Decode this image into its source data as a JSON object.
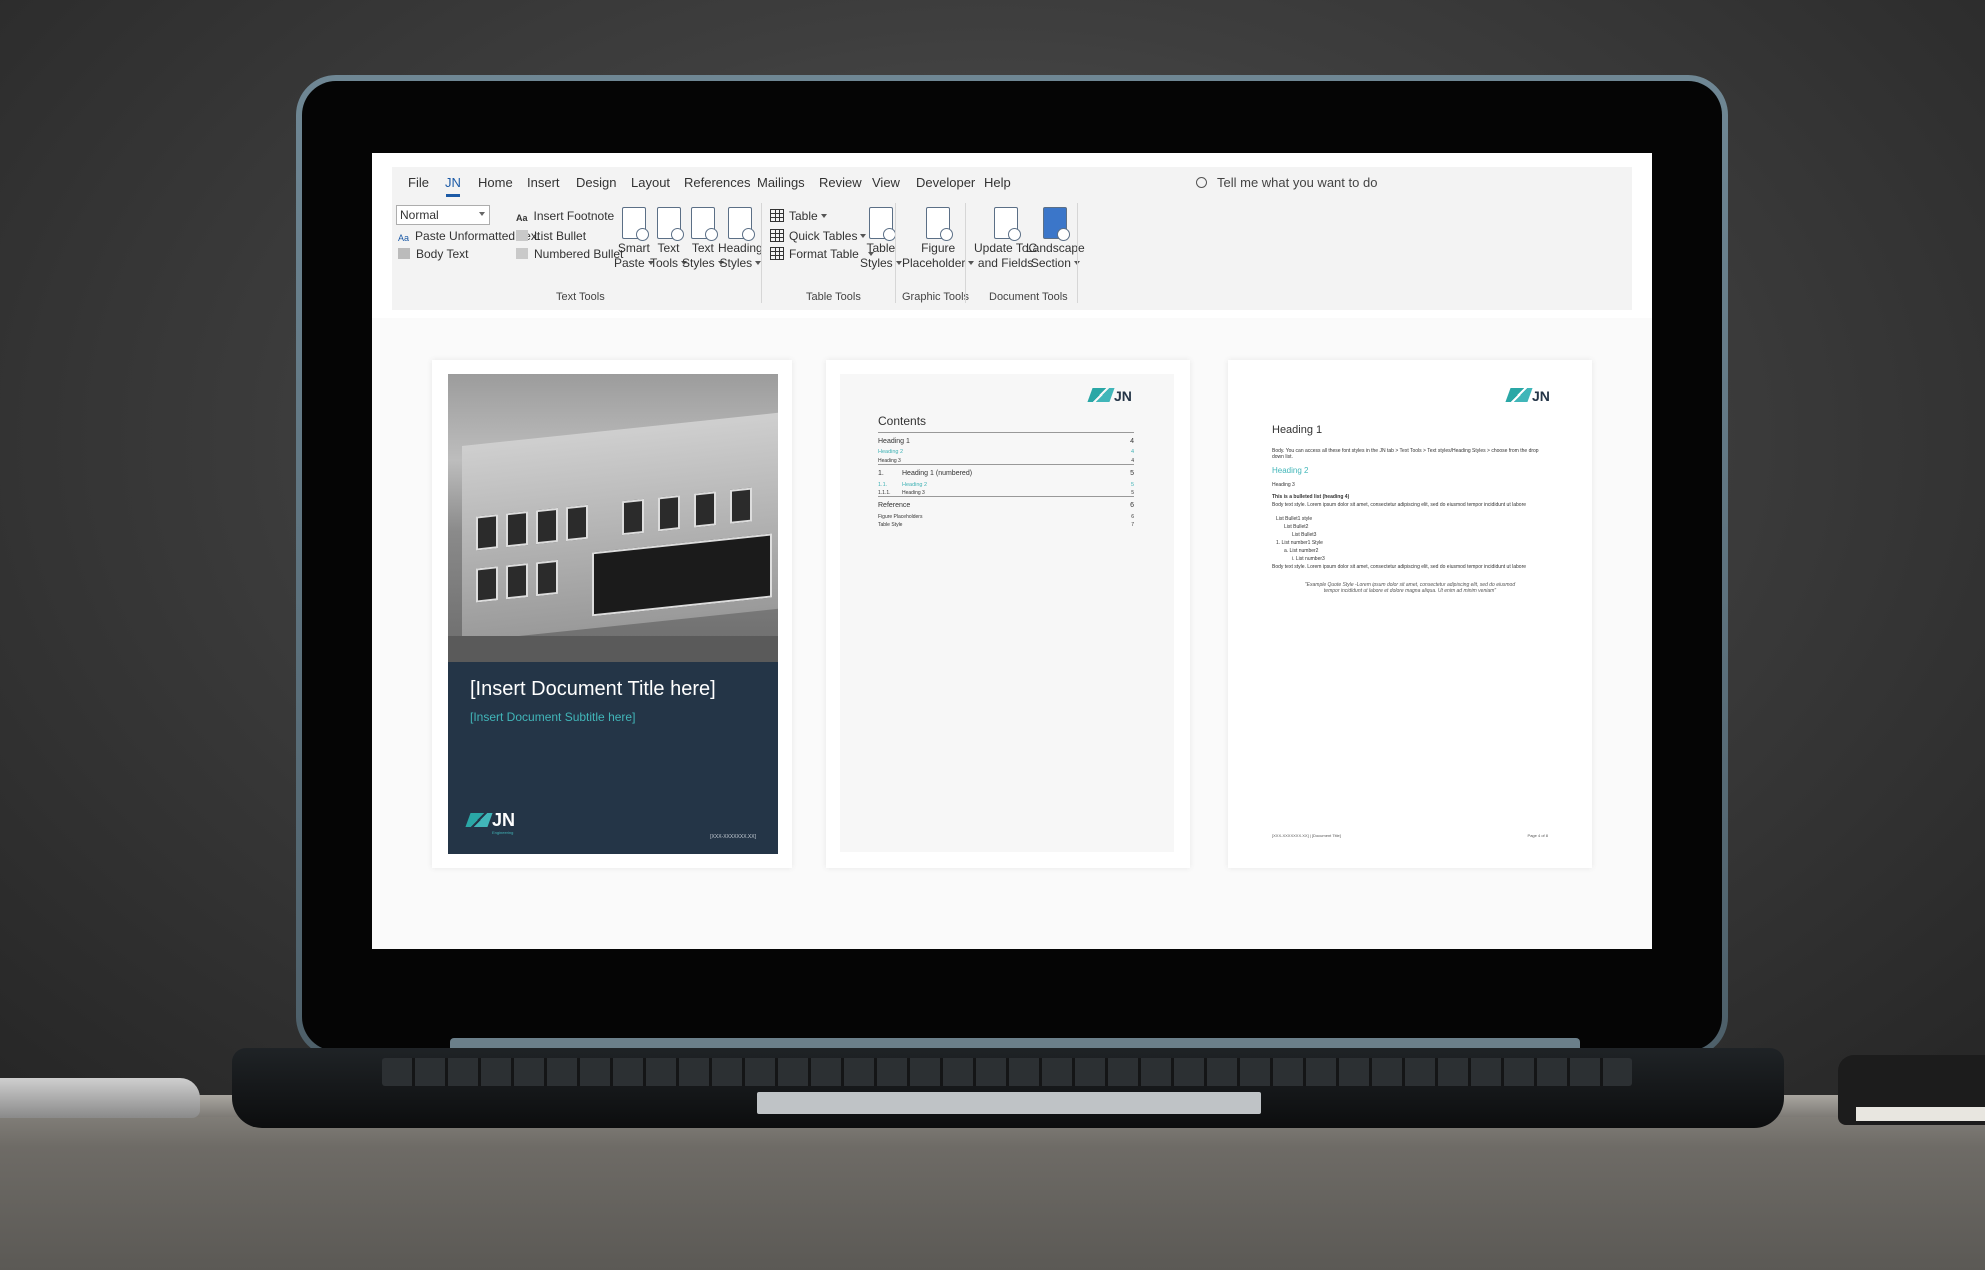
{
  "ribbon": {
    "tabs": [
      "File",
      "JN",
      "Home",
      "Insert",
      "Design",
      "Layout",
      "References",
      "Mailings",
      "Review",
      "View",
      "Developer",
      "Help"
    ],
    "active_tab": "JN",
    "tell_me": "Tell me what you want to do",
    "text_tools": {
      "style_value": "Normal",
      "paste_unformatted": "Paste Unformatted Text",
      "body_text": "Body Text",
      "insert_footnote": "Insert Footnote",
      "list_bullet": "List Bullet",
      "numbered_bullet": "Numbered Bullet",
      "smart_paste": [
        "Smart",
        "Paste"
      ],
      "text_tools_btn": [
        "Text",
        "Tools"
      ],
      "text_styles": [
        "Text",
        "Styles"
      ],
      "heading_styles": [
        "Heading",
        "Styles"
      ],
      "label": "Text Tools"
    },
    "table_tools": {
      "table": "Table",
      "quick_tables": "Quick Tables",
      "format_table": "Format Table",
      "table_styles": [
        "Table",
        "Styles"
      ],
      "label": "Table Tools"
    },
    "graphic_tools": {
      "figure_placeholder": [
        "Figure",
        "Placeholder"
      ],
      "label": "Graphic Tools"
    },
    "document_tools": {
      "update_toc": [
        "Update ToC",
        "and Fields"
      ],
      "landscape": [
        "Landscape",
        "Section"
      ],
      "label": "Document Tools"
    }
  },
  "cover": {
    "title": "[Insert Document Title here]",
    "subtitle": "[Insert Document Subtitle here]",
    "logo": "JN",
    "logo_sub": "Engineering",
    "code": "[XXX-XXXXXXX.XX]"
  },
  "contents": {
    "title": "Contents",
    "logo": "JN",
    "rows": [
      {
        "label": "Heading 1",
        "page": "4",
        "cls": "h1"
      },
      {
        "label": "Heading 2",
        "page": "4",
        "cls": "h2"
      },
      {
        "label": "Heading 3",
        "page": "4",
        "cls": "h3"
      },
      {
        "label": "Heading 1 (numbered)",
        "num": "1.",
        "page": "5",
        "cls": "h1"
      },
      {
        "label": "Heading 2",
        "num": "1.1.",
        "page": "5",
        "cls": "h2"
      },
      {
        "label": "Heading 3",
        "num": "1.1.1.",
        "page": "5",
        "cls": "h3"
      },
      {
        "label": "Reference",
        "page": "6",
        "cls": "h1"
      },
      {
        "label": "Figure Placeholders",
        "page": "6",
        "cls": "h3"
      },
      {
        "label": "Table Style",
        "page": "7",
        "cls": "h3"
      }
    ]
  },
  "body_page": {
    "logo": "JN",
    "heading1": "Heading 1",
    "intro": "Body. You can access all these font styles in the JN tab > Text Tools > Text styles/Heading Styles > choose from the drop down list.",
    "heading2": "Heading 2",
    "heading3": "Heading 3",
    "heading4": "This is a bulleted list (heading 4)",
    "body1": "Body text style. Lorem ipsum dolor sit amet, consectetur adipiscing elit, sed do eiusmod tempor incididunt ut labore",
    "bullets": [
      "List Bullet1 style",
      "List Bullet2",
      "List Bullet3",
      "1. List number1 Style",
      "a. List number2",
      "i. List number3"
    ],
    "body2": "Body text style. Lorem ipsum dolor sit amet, consectetur adipiscing elit, sed do eiusmod tempor incididunt ut labore",
    "quote": "\"Example Quote Style -Lorem ipsum dolor sit amet, consectetur adipiscing elit, sed do eiusmod tempor incididunt ut labore et dolore magna aliqua. Ut enim ad minim veniam\"",
    "footer_left": "[XXX-XXXXXXX.XX] | [Document Title]",
    "footer_right": "Page 4 of 8"
  }
}
